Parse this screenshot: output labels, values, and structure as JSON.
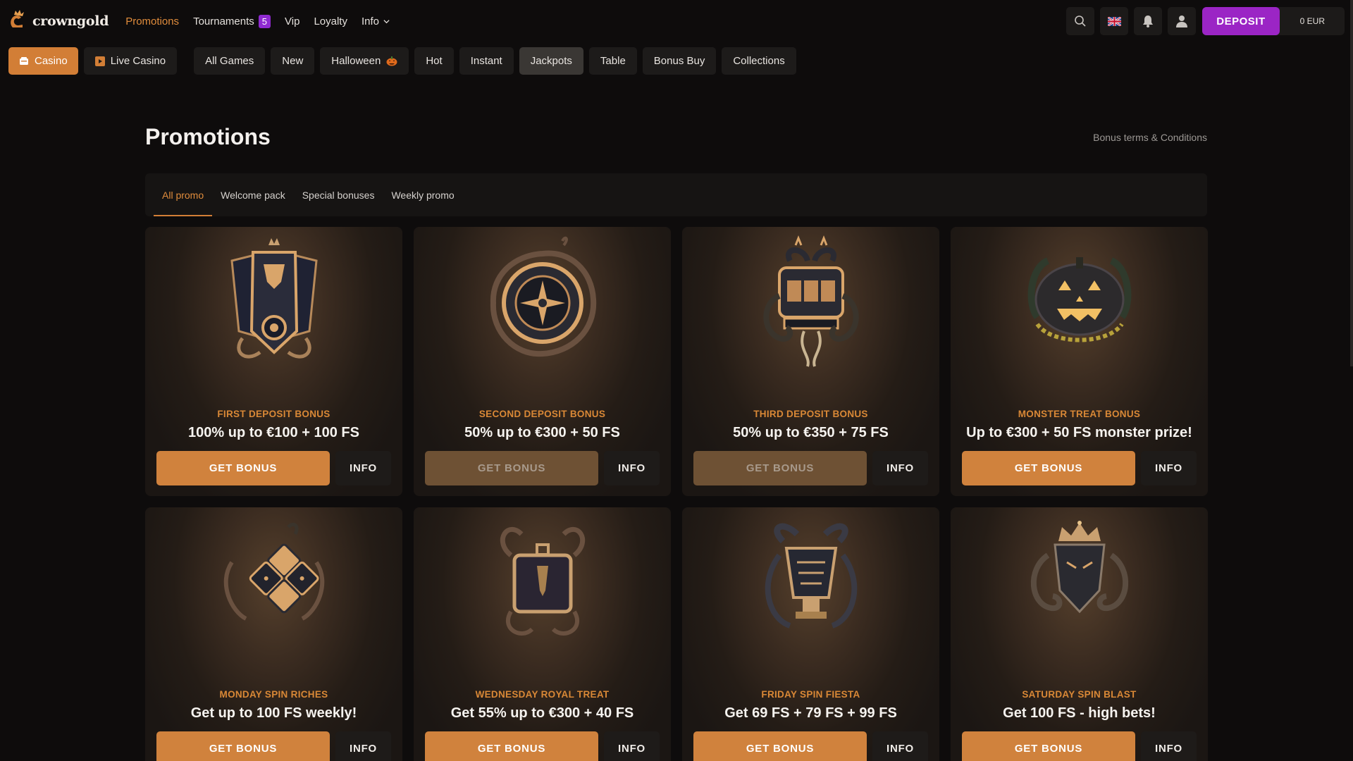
{
  "header": {
    "logo_text": "crowngold",
    "nav": [
      {
        "label": "Promotions",
        "active": true
      },
      {
        "label": "Tournaments",
        "badge": "5"
      },
      {
        "label": "Vip"
      },
      {
        "label": "Loyalty"
      },
      {
        "label": "Info"
      }
    ],
    "deposit_label": "DEPOSIT",
    "balance": "0 EUR",
    "icons": [
      "search-icon",
      "uk-flag-icon",
      "bell-icon",
      "user-icon"
    ]
  },
  "categories": {
    "primary": [
      {
        "label": "Casino",
        "icon": "casino-icon",
        "active": true
      },
      {
        "label": "Live Casino",
        "icon": "live-icon"
      }
    ],
    "secondary": [
      {
        "label": "All Games"
      },
      {
        "label": "New"
      },
      {
        "label": "Halloween",
        "icon": "pumpkin-icon"
      },
      {
        "label": "Hot"
      },
      {
        "label": "Instant"
      },
      {
        "label": "Jackpots",
        "highlighted": true
      },
      {
        "label": "Table"
      },
      {
        "label": "Bonus Buy"
      },
      {
        "label": "Collections"
      }
    ]
  },
  "promotions": {
    "title": "Promotions",
    "terms_link": "Bonus terms & Conditions",
    "tabs": [
      {
        "label": "All promo",
        "active": true
      },
      {
        "label": "Welcome pack"
      },
      {
        "label": "Special bonuses"
      },
      {
        "label": "Weekly promo"
      }
    ],
    "cards": [
      {
        "title": "FIRST DEPOSIT BONUS",
        "desc": "100% up to €100 + 100 FS",
        "button": "GET BONUS",
        "info": "INFO",
        "disabled": false,
        "art": "shield-cards-icon"
      },
      {
        "title": "SECOND DEPOSIT BONUS",
        "desc": "50% up to €300 + 50 FS",
        "button": "GET BONUS",
        "info": "INFO",
        "disabled": true,
        "art": "roulette-snake-icon"
      },
      {
        "title": "THIRD DEPOSIT BONUS",
        "desc": "50% up to €350 + 75 FS",
        "button": "GET BONUS",
        "info": "INFO",
        "disabled": true,
        "art": "slot-machine-icon"
      },
      {
        "title": "MONSTER TREAT BONUS",
        "desc": "Up to €300 + 50 FS monster prize!",
        "button": "GET BONUS",
        "info": "INFO",
        "disabled": false,
        "art": "pumpkin-snake-icon"
      },
      {
        "title": "MONDAY SPIN RICHES",
        "desc": "Get up to 100 FS weekly!",
        "button": "GET BONUS",
        "info": "INFO",
        "disabled": false,
        "art": "dice-snake-icon"
      },
      {
        "title": "WEDNESDAY ROYAL TREAT",
        "desc": "Get 55% up to €300 + 40 FS",
        "button": "GET BONUS",
        "info": "INFO",
        "disabled": false,
        "art": "treasure-chest-icon"
      },
      {
        "title": "FRIDAY SPIN FIESTA",
        "desc": "Get 69 FS + 79 FS + 99 FS",
        "button": "GET BONUS",
        "info": "INFO",
        "disabled": false,
        "art": "goblet-snake-icon"
      },
      {
        "title": "SATURDAY SPIN BLAST",
        "desc": "Get 100 FS - high bets!",
        "button": "GET BONUS",
        "info": "INFO",
        "disabled": false,
        "art": "crowned-snake-icon"
      }
    ]
  },
  "colors": {
    "accent": "#d0823d",
    "accent_text": "#e08c3c",
    "deposit": "#9b25c5",
    "background": "#0e0c0c"
  }
}
